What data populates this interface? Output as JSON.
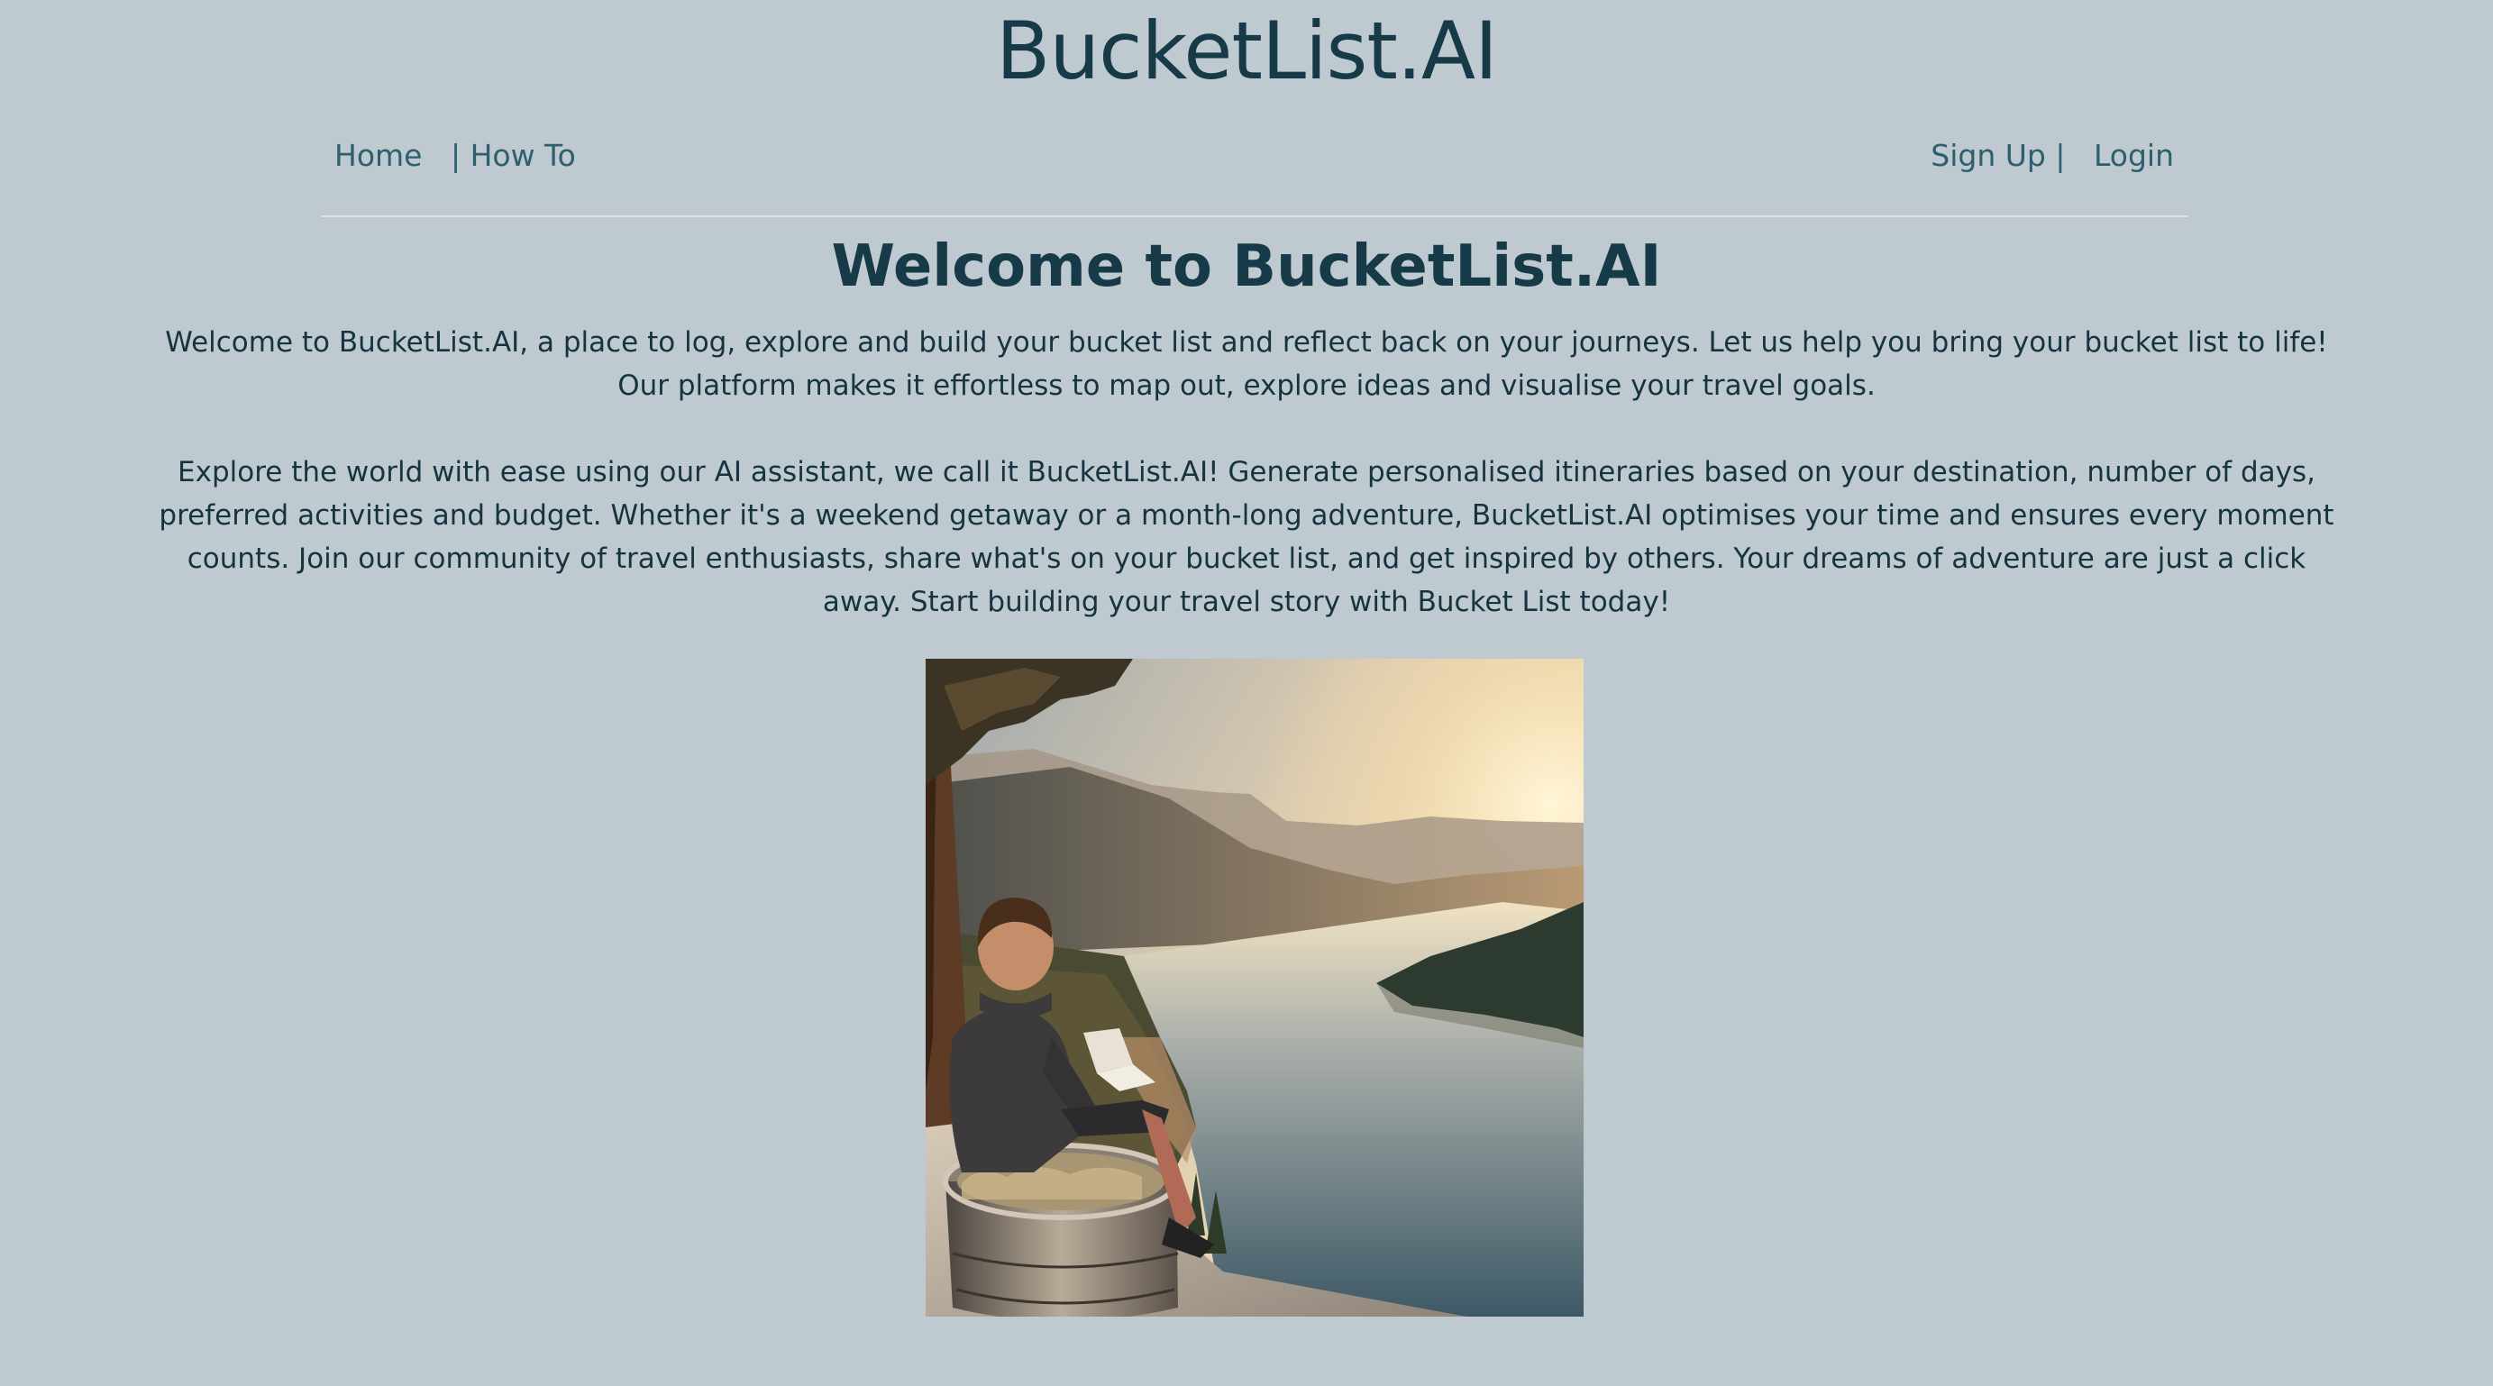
{
  "site": {
    "title": "BucketList.AI"
  },
  "nav": {
    "left": {
      "home": "Home",
      "separator": "|",
      "how_to": "How To"
    },
    "right": {
      "sign_up": "Sign Up",
      "separator": "|",
      "login": "Login"
    }
  },
  "main": {
    "heading": "Welcome to BucketList.AI",
    "paragraphs": [
      "Welcome to BucketList.AI, a place to log, explore and build your bucket list and reflect back on your journeys. Let us help you bring your bucket list to life! Our platform makes it effortless to map out, explore ideas and visualise your travel goals.",
      "Explore the world with ease using our AI assistant, we call it BucketList.AI! Generate personalised itineraries based on your destination, number of days, preferred activities and budget. Whether it's a weekend getaway or a month-long adventure, BucketList.AI optimises your time and ensures every moment counts. Join our community of travel enthusiasts, share what's on your bucket list, and get inspired by others. Your dreams of adventure are just a click away. Start building your travel story with Bucket List today!"
    ],
    "hero_image": {
      "icon": "hero-illustration"
    }
  },
  "colors": {
    "background": "#bfcad0",
    "heading": "#163a48",
    "link": "#2d5f6e",
    "body_text": "#163440"
  }
}
